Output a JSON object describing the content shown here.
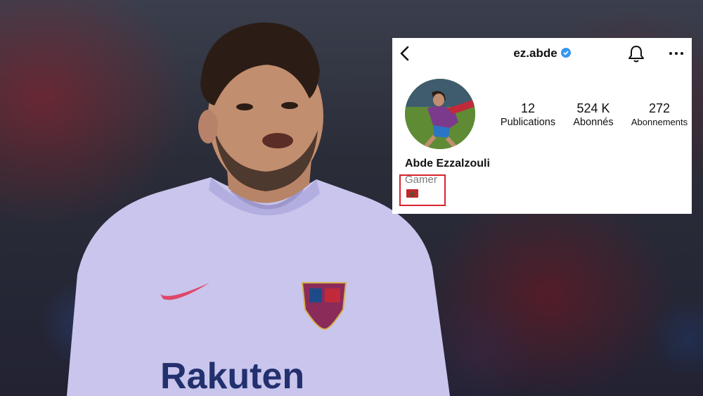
{
  "profile": {
    "username": "ez.abde",
    "full_name": "Abde Ezzalzouli",
    "bio": "Gamer",
    "stats": [
      {
        "value": "12",
        "label": "Publications"
      },
      {
        "value": "524 K",
        "label": "Abonnés"
      },
      {
        "value": "272",
        "label": "Abonnements"
      }
    ],
    "flag": "Morocco flag emoji"
  },
  "photo": {
    "jersey_sponsor": "Rakuten"
  },
  "icons": [
    "back-arrow-icon",
    "verified-badge-icon",
    "bell-icon",
    "more-options-icon"
  ],
  "colors": {
    "verified": "#3897f0",
    "highlight": "#d9232e",
    "flag_red": "#c1272d",
    "jersey": "#c9c5ec"
  }
}
